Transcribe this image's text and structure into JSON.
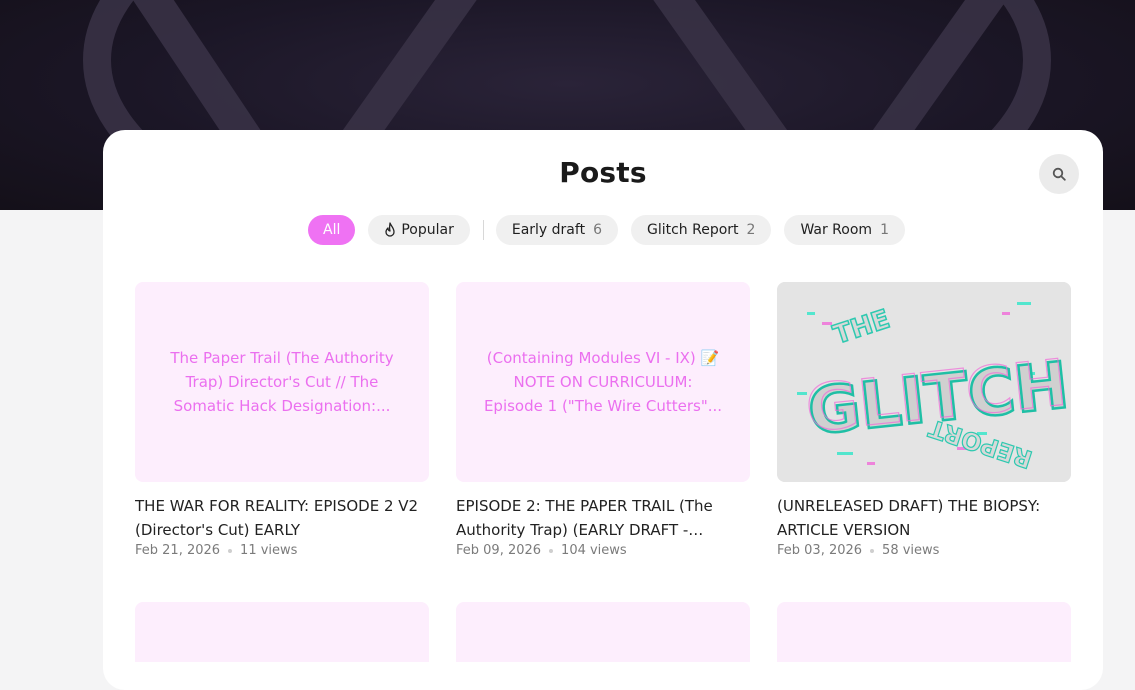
{
  "page": {
    "title": "Posts"
  },
  "search": {
    "icon": "search-icon"
  },
  "filters": {
    "all": "All",
    "popular": "Popular",
    "tags": [
      {
        "label": "Early draft",
        "count": "6"
      },
      {
        "label": "Glitch Report",
        "count": "2"
      },
      {
        "label": "War Room",
        "count": "1"
      }
    ]
  },
  "posts": [
    {
      "thumb_text": "The Paper Trail (The Authority Trap) Director's Cut // The Somatic Hack Designation:...",
      "title": "THE WAR FOR REALITY: EPISODE 2 V2 (Director's Cut) EARLY",
      "date": "Feb 21, 2026",
      "views": "11 views"
    },
    {
      "thumb_text": "(Containing Modules VI - IX) 📝 NOTE ON CURRICULUM: Episode 1 (\"The Wire Cutters\"...",
      "title": "EPISODE 2: THE PAPER TRAIL (The Authority Trap) (EARLY DRAFT - Media...",
      "date": "Feb 09, 2026",
      "views": "104 views"
    },
    {
      "thumb_image_text": [
        "THE",
        "GLITCH",
        "REPORT"
      ],
      "title": "(UNRELEASED DRAFT) THE BIOPSY: ARTICLE VERSION",
      "date": "Feb 03, 2026",
      "views": "58 views"
    }
  ],
  "colors": {
    "accent": "#ef72f3",
    "thumb_bg": "#fdeefd",
    "thumb_text": "#eb6fef",
    "hero_bg": "#1b1626"
  }
}
